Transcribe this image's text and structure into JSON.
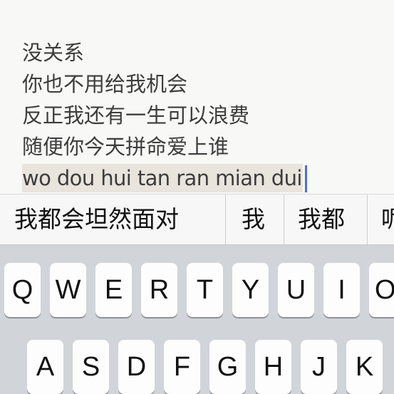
{
  "note": {
    "lines": [
      "没关系",
      "你也不用给我机会",
      "反正我还有一生可以浪费",
      "随便你今天拼命爱上谁"
    ],
    "marked_text": "wo dou hui tan ran mian dui"
  },
  "candidates": [
    "我都会坦然面对",
    "我",
    "我都",
    "呢"
  ],
  "keyboard": {
    "row1": [
      "Q",
      "W",
      "E",
      "R",
      "T",
      "Y",
      "U",
      "I",
      "O"
    ],
    "row2": [
      "A",
      "S",
      "D",
      "F",
      "G",
      "H",
      "J",
      "K"
    ]
  }
}
